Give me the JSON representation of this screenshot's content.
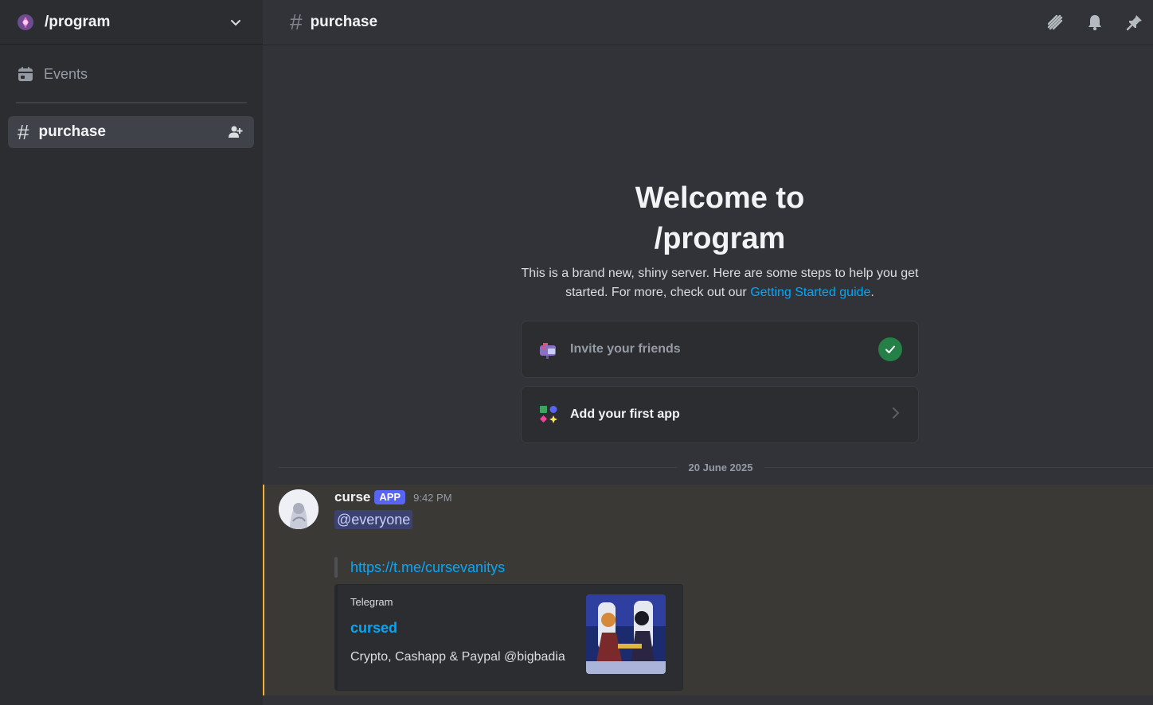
{
  "server": {
    "name": "/program"
  },
  "sidebar": {
    "events_label": "Events",
    "channels": [
      {
        "label": "purchase",
        "selected": true
      }
    ]
  },
  "topbar": {
    "channel_name": "purchase"
  },
  "welcome": {
    "title_line1": "Welcome to",
    "title_line2": "/program",
    "subtitle_text": "This is a brand new, shiny server. Here are some steps to help you get started. For more, check out our ",
    "guide_link": "Getting Started guide",
    "subtitle_end": ".",
    "cards": [
      {
        "label": "Invite your friends",
        "completed": true
      },
      {
        "label": "Add your first app",
        "completed": false
      }
    ]
  },
  "date_divider": "20 June 2025",
  "message": {
    "author": "curse",
    "badge": "APP",
    "time": "9:42 PM",
    "mention": "@everyone",
    "quote_link": "https://t.me/cursevanitys",
    "embed": {
      "provider": "Telegram",
      "title": "cursed",
      "description": "Crypto, Cashapp & Paypal @bigbadia"
    }
  },
  "colors": {
    "accent": "#5865f2",
    "link": "#00a8fc",
    "success": "#248046",
    "highlight_border": "#f0b232"
  }
}
